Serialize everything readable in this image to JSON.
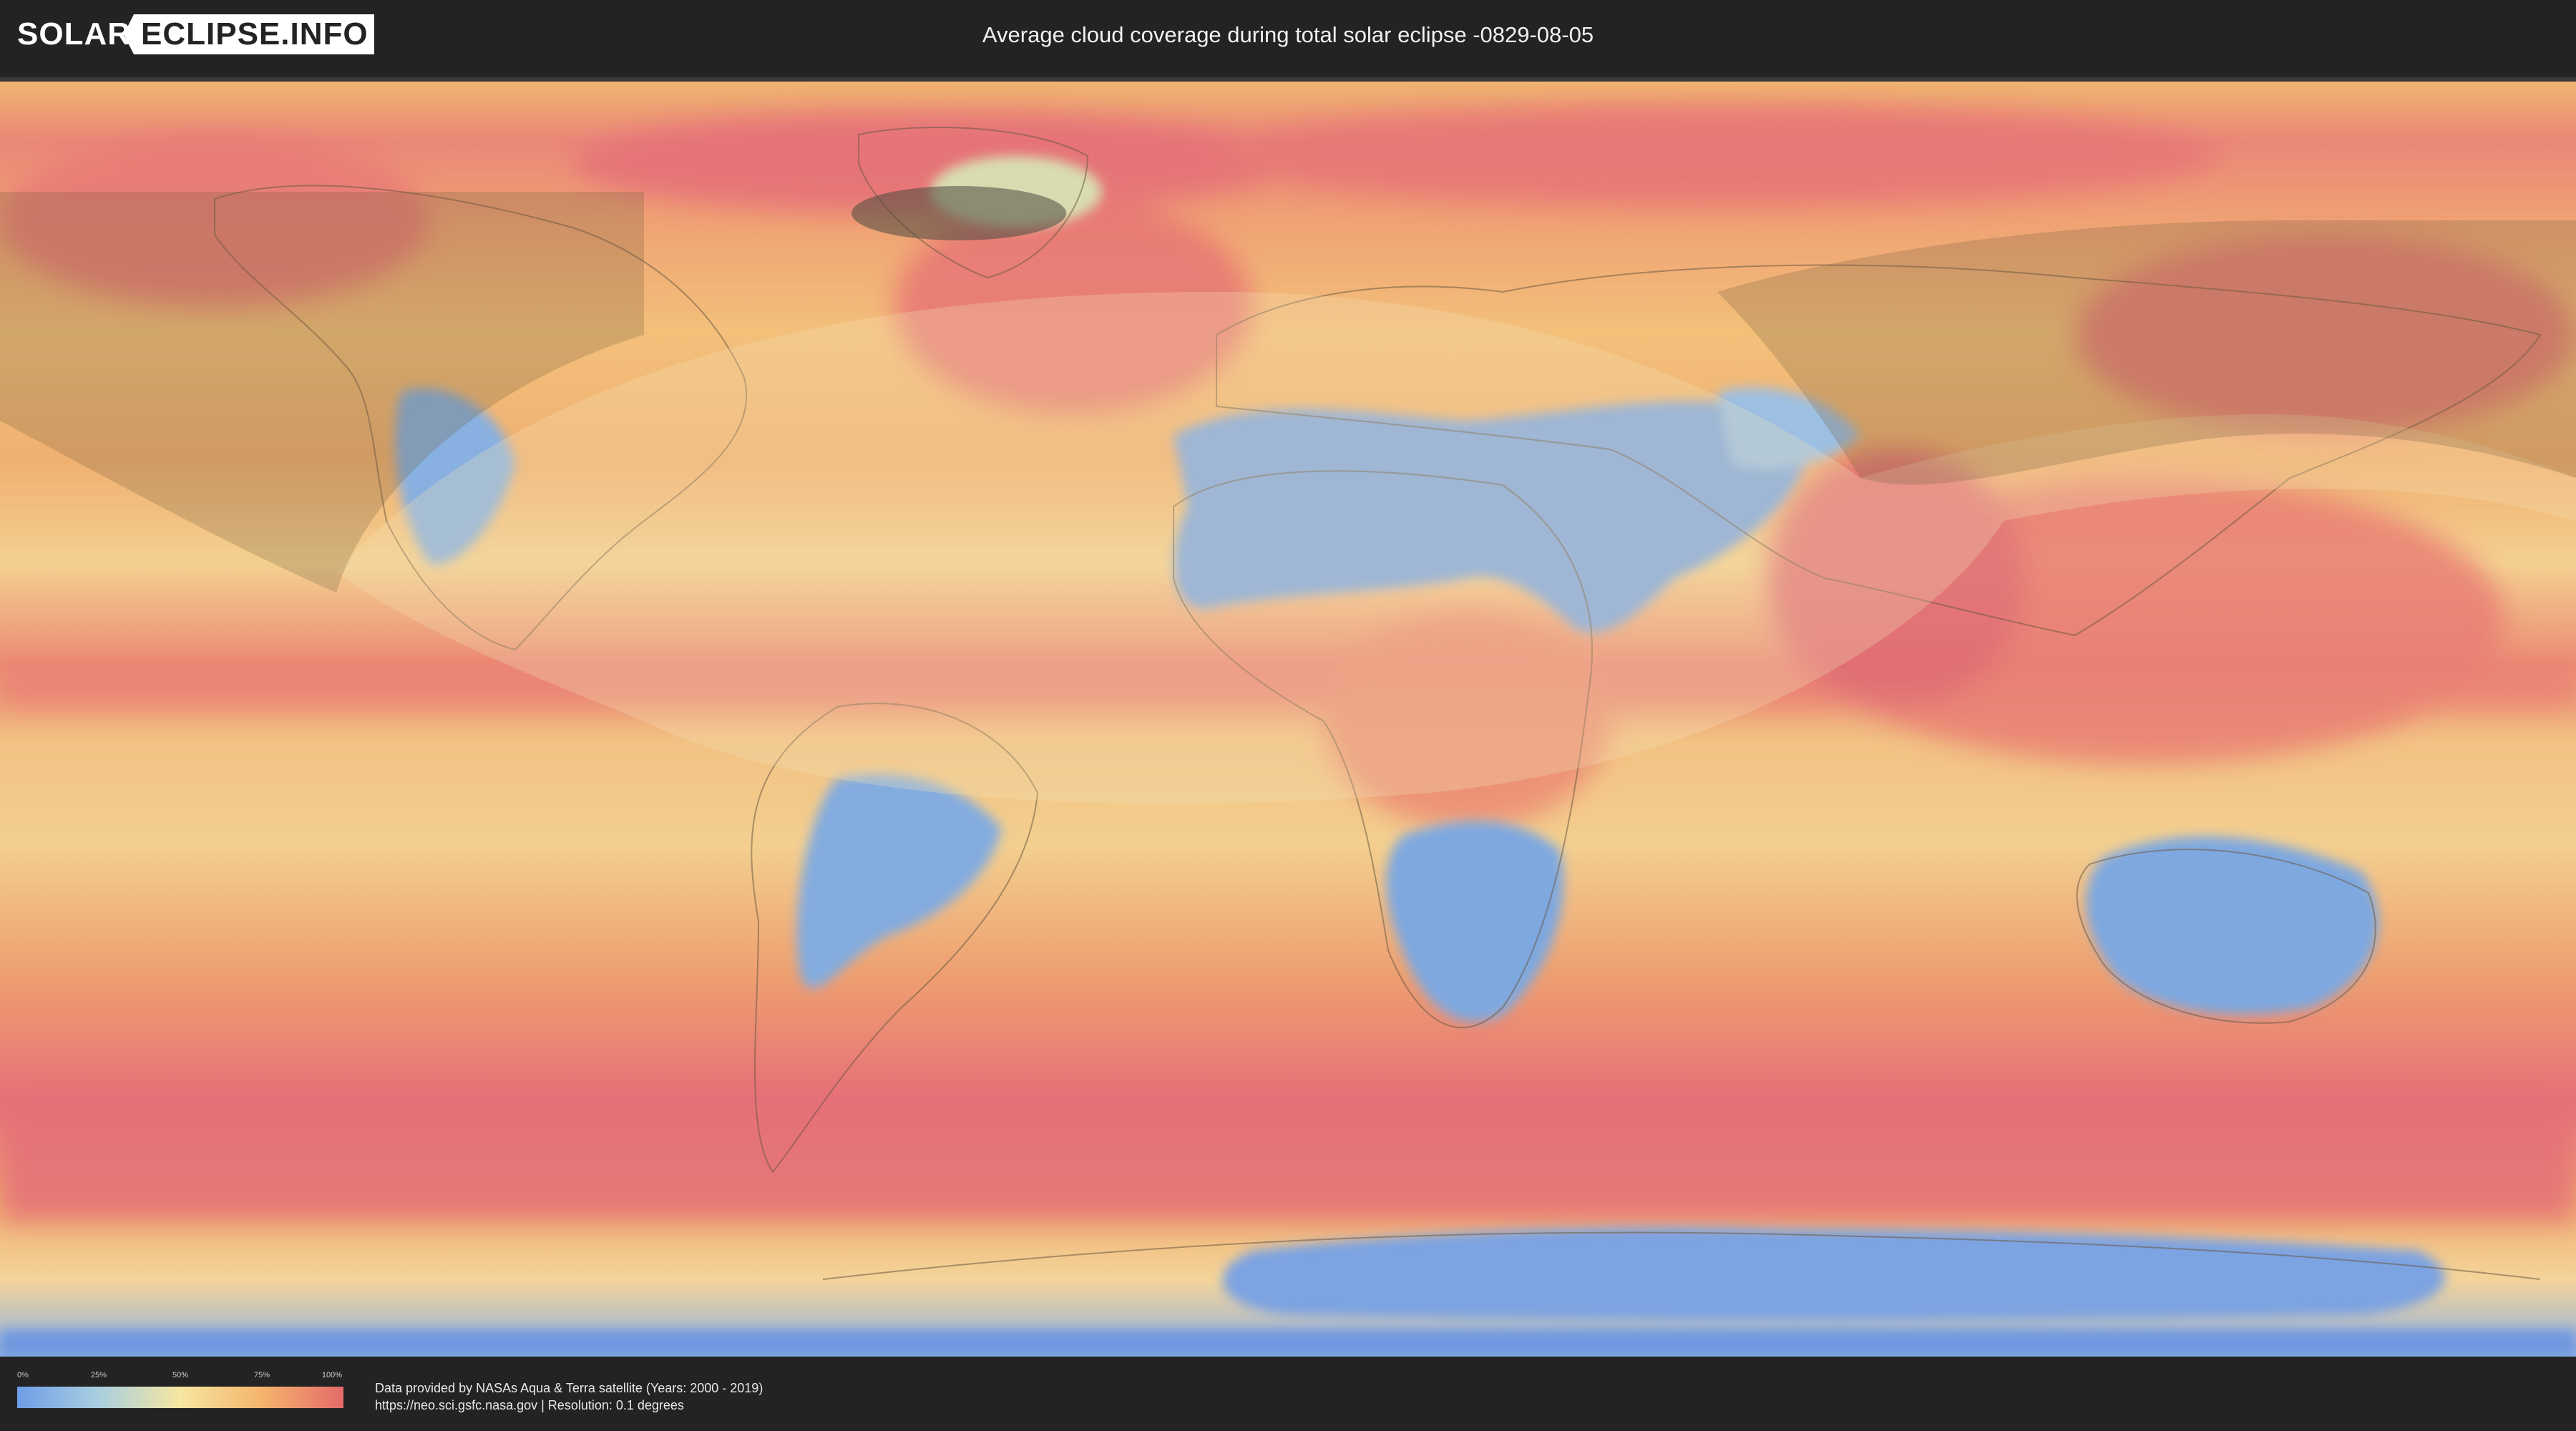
{
  "logo": {
    "part1": "SOLAR",
    "part2": "ECLIPSE.INFO"
  },
  "title": "Average cloud coverage during total solar eclipse -0829-08-05",
  "legend": {
    "ticks": [
      "0%",
      "25%",
      "50%",
      "75%",
      "100%"
    ],
    "colors": {
      "low": "#6f9de6",
      "lowmid": "#a9cfe0",
      "mid": "#f6e6a0",
      "highmid": "#f4b46d",
      "high": "#e56a6a"
    }
  },
  "credits": {
    "line1": "Data provided by NASAs Aqua & Terra satellite (Years: 2000 - 2019)",
    "line2": "https://neo.sci.gsfc.nasa.gov | Resolution: 0.1 degrees"
  },
  "map": {
    "colors": {
      "ocean_base": "#f2b56e",
      "cloudy": "#e8707a",
      "clear": "#7aa6e0",
      "clear_light": "#a9c8e4",
      "pale": "#f4dca0",
      "overlay": "#5a4a30"
    }
  }
}
